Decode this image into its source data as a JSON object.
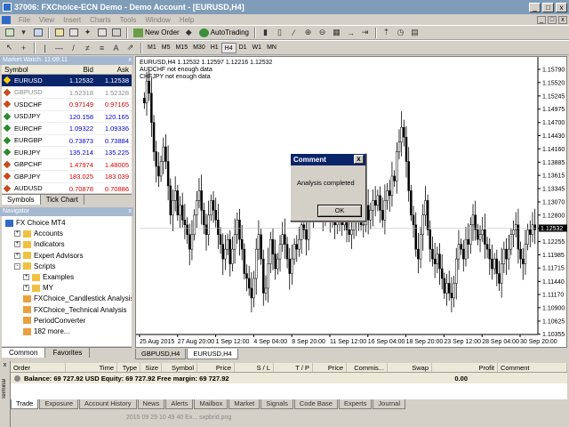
{
  "window": {
    "title": "37006: FXChoice-ECN Demo - Demo Account - [EURUSD,H4]",
    "min": "_",
    "max": "□",
    "close": "x"
  },
  "menu": [
    "File",
    "View",
    "Insert",
    "Charts",
    "Tools",
    "Window",
    "Help"
  ],
  "toolbar": {
    "new_order": "New Order",
    "autotrading": "AutoTrading",
    "timeframes": [
      "M1",
      "M5",
      "M15",
      "M30",
      "H1",
      "H4",
      "D1",
      "W1",
      "MN"
    ],
    "active_timeframe": "H4"
  },
  "market_watch": {
    "title": "Market Watch: 11:09:11",
    "close": "x",
    "columns": {
      "symbol": "Symbol",
      "bid": "Bid",
      "ask": "Ask"
    },
    "rows": [
      {
        "symbol": "EURUSD",
        "bid": "1.12532",
        "ask": "1.12538",
        "color": "#ffffff",
        "selected": true
      },
      {
        "symbol": "GBPUSD",
        "bid": "1.52318",
        "ask": "1.52328",
        "color": "#888888",
        "gray": true
      },
      {
        "symbol": "USDCHF",
        "bid": "0.97149",
        "ask": "0.97165",
        "color": "#d40000"
      },
      {
        "symbol": "USDJPY",
        "bid": "120.158",
        "ask": "120.165",
        "color": "#0000cc"
      },
      {
        "symbol": "EURCHF",
        "bid": "1.09322",
        "ask": "1.09336",
        "color": "#0000cc"
      },
      {
        "symbol": "EURGBP",
        "bid": "0.73873",
        "ask": "0.73884",
        "color": "#0000cc"
      },
      {
        "symbol": "EURJPY",
        "bid": "135.214",
        "ask": "135.225",
        "color": "#0000cc"
      },
      {
        "symbol": "GBPCHF",
        "bid": "1.47974",
        "ask": "1.48005",
        "color": "#d40000"
      },
      {
        "symbol": "GBPJPY",
        "bid": "183.025",
        "ask": "183.039",
        "color": "#d40000"
      },
      {
        "symbol": "AUDUSD",
        "bid": "0.70878",
        "ask": "0.70886",
        "color": "#d40000"
      }
    ],
    "tabs": [
      "Symbols",
      "Tick Chart"
    ]
  },
  "navigator": {
    "title": "Navigator",
    "close": "x",
    "items": [
      {
        "label": "FX Choice MT4",
        "pm": ""
      },
      {
        "label": "Accounts",
        "pm": "+"
      },
      {
        "label": "Indicators",
        "pm": "+"
      },
      {
        "label": "Expert Advisors",
        "pm": "+"
      },
      {
        "label": "Scripts",
        "pm": "-"
      },
      {
        "label": "Examples",
        "pm": "+"
      },
      {
        "label": "MY",
        "pm": "+"
      },
      {
        "label": "FXChoice_Candlestick Analysis",
        "pm": ""
      },
      {
        "label": "FXChoice_Technical Analysis",
        "pm": ""
      },
      {
        "label": "PeriodConverter",
        "pm": ""
      },
      {
        "label": "182 more...",
        "pm": ""
      }
    ],
    "tabs": [
      "Common",
      "Favorites"
    ]
  },
  "chart": {
    "header": "EURUSD,H4  1.12532 1.12597 1.12216 1.12532",
    "notes": [
      "AUDCHF not enough data",
      "CHFJPY not enough data"
    ],
    "price_labels": [
      "1.15790",
      "1.15520",
      "1.15245",
      "1.14975",
      "1.14700",
      "1.14430",
      "1.14160",
      "1.13885",
      "1.13615",
      "1.13345",
      "1.13070",
      "1.12800",
      "1.12530",
      "1.12255",
      "1.11985",
      "1.11715",
      "1.11440",
      "1.11170",
      "1.10900",
      "1.10625",
      "1.10355"
    ],
    "current_price": "1.12532",
    "time_labels": [
      "25 Aug 2015",
      "27 Aug 20:00",
      "1 Sep 12:00",
      "4 Sep 04:00",
      "8 Sep 20:00",
      "11 Sep 12:00",
      "16 Sep 04:00",
      "18 Sep 20:00",
      "23 Sep 12:00",
      "28 Sep 04:00",
      "30 Sep 20:00"
    ],
    "tabs": [
      "GBPUSD,H4",
      "EURUSD,H4"
    ],
    "active_tab": "EURUSD,H4"
  },
  "chart_data": {
    "type": "candlestick",
    "symbol": "EURUSD",
    "timeframe": "H4",
    "ylim": [
      1.1035,
      1.1579
    ],
    "x_start": "25 Aug 2015",
    "x_end": "2 Oct 2015",
    "closes": [
      1.151,
      1.1555,
      1.153,
      1.147,
      1.141,
      1.138,
      1.136,
      1.139,
      1.142,
      1.139,
      1.134,
      1.128,
      1.131,
      1.133,
      1.128,
      1.13,
      1.127,
      1.126,
      1.124,
      1.121,
      1.124,
      1.128,
      1.131,
      1.133,
      1.129,
      1.126,
      1.124,
      1.128,
      1.131,
      1.129,
      1.127,
      1.124,
      1.122,
      1.119,
      1.121,
      1.123,
      1.118,
      1.121,
      1.124,
      1.127,
      1.123,
      1.121,
      1.116,
      1.115,
      1.113,
      1.111,
      1.115,
      1.121,
      1.124,
      1.119,
      1.112,
      1.113,
      1.118,
      1.123,
      1.12,
      1.117,
      1.119,
      1.122,
      1.124,
      1.122,
      1.119,
      1.116,
      1.119,
      1.122,
      1.121,
      1.123,
      1.126,
      1.125,
      1.123,
      1.128,
      1.128,
      1.131,
      1.133,
      1.132,
      1.13,
      1.128,
      1.129,
      1.128,
      1.127,
      1.129,
      1.126,
      1.131,
      1.128,
      1.126,
      1.127,
      1.125,
      1.124,
      1.125,
      1.128,
      1.127,
      1.128,
      1.126,
      1.126,
      1.13,
      1.127,
      1.129,
      1.131,
      1.13,
      1.132,
      1.129,
      1.127,
      1.131,
      1.133,
      1.132,
      1.136,
      1.135,
      1.141,
      1.143,
      1.146,
      1.144,
      1.139,
      1.133,
      1.128,
      1.126,
      1.121,
      1.119,
      1.124,
      1.128,
      1.131,
      1.125,
      1.121,
      1.119,
      1.118,
      1.12,
      1.117,
      1.115,
      1.112,
      1.114,
      1.112,
      1.111,
      1.114,
      1.119,
      1.122,
      1.121,
      1.119,
      1.123,
      1.122,
      1.126,
      1.128,
      1.125,
      1.123,
      1.124,
      1.125,
      1.122,
      1.121,
      1.119,
      1.117,
      1.119,
      1.116,
      1.114,
      1.118,
      1.121,
      1.119,
      1.121,
      1.124,
      1.125,
      1.126,
      1.121,
      1.119,
      1.118,
      1.122,
      1.125,
      1.124,
      1.126,
      1.125
    ]
  },
  "dialog": {
    "title": "Comment",
    "close": "x",
    "message": "Analysis completed",
    "ok": "OK"
  },
  "terminal": {
    "close": "x",
    "side_label": "Terminal",
    "columns": [
      "Order",
      "Time",
      "Type",
      "Size",
      "Symbol",
      "Price",
      "S / L",
      "T / P",
      "Price",
      "Commis...",
      "Swap",
      "Profit",
      "Comment"
    ],
    "balance_line": "Balance: 69 727.92 USD  Equity: 69 727.92  Free margin: 69 727.92",
    "profit": "0.00",
    "tabs": [
      "Trade",
      "Exposure",
      "Account History",
      "News",
      "Alerts",
      "Mailbox",
      "Market",
      "Signals",
      "Code Base",
      "Experts",
      "Journal"
    ],
    "active_tab": "Trade",
    "background_text": "2015 09 29 10 49 40 Ex... sxpbrid.png"
  }
}
